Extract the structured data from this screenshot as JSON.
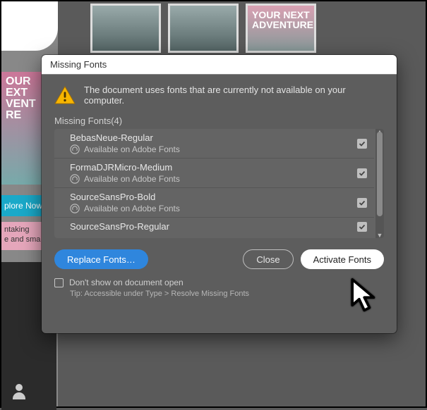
{
  "bg": {
    "text_overlay_big": "YOUR NEXT ADVENTURE",
    "text_overlay_side": "OUR EXT VENT RE",
    "btn_explore": "plore Now",
    "teaser_line1": "ntaking",
    "teaser_line2": "e and sma"
  },
  "dialog": {
    "title": "Missing Fonts",
    "warning": "The document uses fonts that are currently not available on your computer.",
    "list_header": "Missing Fonts(4)",
    "available_label": "Available on Adobe Fonts",
    "fonts": [
      {
        "name": "BebasNeue-Regular",
        "sub": true
      },
      {
        "name": "FormaDJRMicro-Medium",
        "sub": true
      },
      {
        "name": "SourceSansPro-Bold",
        "sub": true
      },
      {
        "name": "SourceSansPro-Regular",
        "sub": false
      }
    ],
    "buttons": {
      "replace": "Replace Fonts…",
      "close": "Close",
      "activate": "Activate Fonts"
    },
    "dont_show": "Don't show on document open",
    "tip": "Tip: Accessible under Type > Resolve Missing Fonts"
  }
}
